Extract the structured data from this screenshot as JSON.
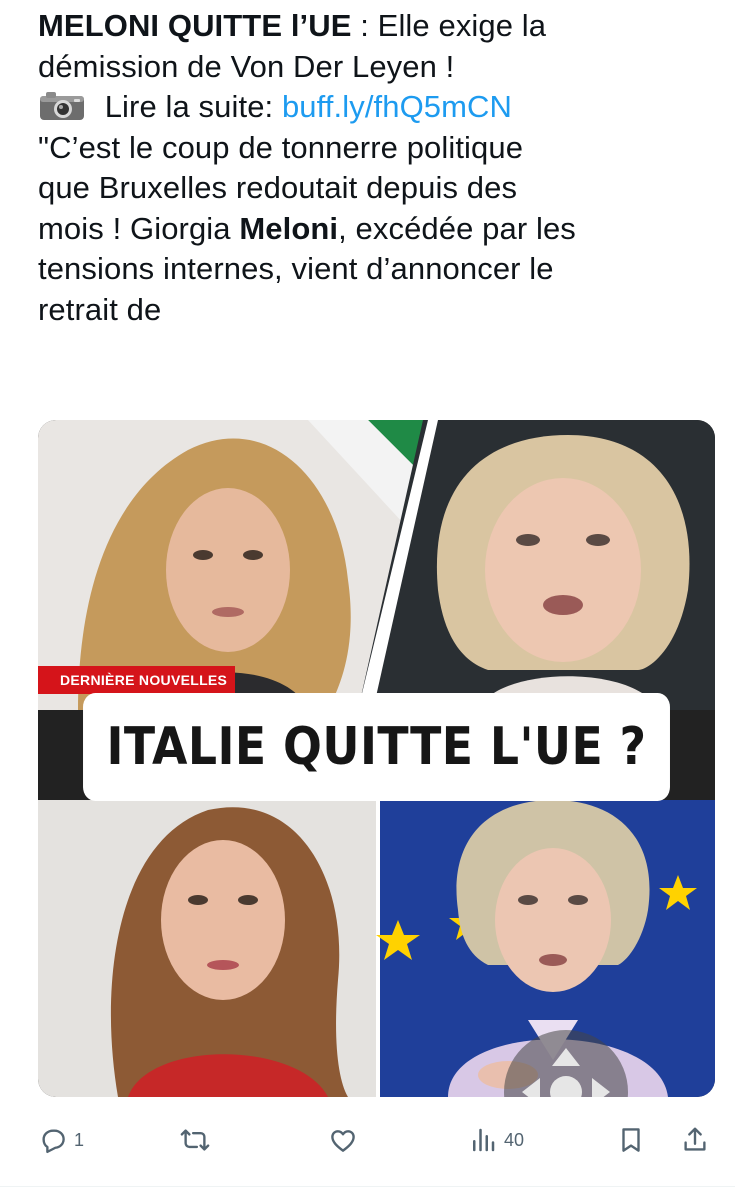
{
  "tweet": {
    "headline_bold": "MELONI QUITTE l’UE",
    "headline_rest": " : Elle exige la",
    "line2": "démission de Von Der Leyen !",
    "read_more_label": " Lire la suite: ",
    "link_text": "buff.ly/fhQ5mCN",
    "line4": "\"C’est le coup de tonnerre politique",
    "line5": "que Bruxelles redoutait depuis des",
    "line6_pre": "mois ! Giorgia ",
    "line6_bold": "Meloni",
    "line6_post": ", excédée par les",
    "line7": "tensions internes, vient d’annoncer le",
    "line8": "retrait de"
  },
  "media": {
    "tag_label": "DERNIÈRE NOUVELLES",
    "headline": "ITALIE QUITTE L'UE ?",
    "icons": [
      "camera-emoji",
      "move-arrows-icon"
    ]
  },
  "actions": {
    "reply_count": "1",
    "retweet_count": "",
    "like_count": "",
    "views_count": "40",
    "icons": [
      "reply-icon",
      "retweet-icon",
      "like-icon",
      "views-icon",
      "bookmark-icon",
      "share-icon"
    ]
  },
  "colors": {
    "text": "#0f1419",
    "link": "#1d9bf0",
    "muted": "#536471",
    "tag_red": "#d5141a",
    "eu_blue": "#1f3f9a"
  }
}
